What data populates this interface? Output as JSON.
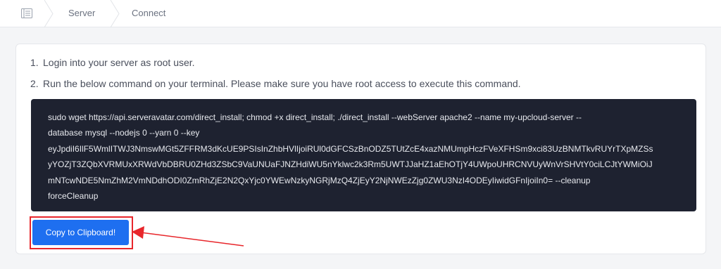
{
  "breadcrumb": {
    "items": [
      "Server",
      "Connect"
    ]
  },
  "steps": [
    {
      "num": "1.",
      "text": "Login into your server as root user."
    },
    {
      "num": "2.",
      "text": "Run the below command on your terminal. Please make sure you have root access to execute this command."
    }
  ],
  "command": {
    "lines": [
      "sudo wget https://api.serveravatar.com/direct_install; chmod +x direct_install; ./direct_install --webServer apache2 --name my-upcloud-server --",
      "database mysql --nodejs 0 --yarn 0 --key",
      "eyJpdiI6IlF5WmlITWJ3NmswMGt5ZFFRM3dKcUE9PSIsInZhbHVlIjoiRUl0dGFCSzBnODZ5TUtZcE4xazNMUmpHczFVeXFHSm9xci83UzBNMTkvRUYrTXpMZSs",
      "yYOZjT3ZQbXVRMUxXRWdVbDBRU0ZHd3ZSbC9VaUNUaFJNZHdiWU5nYklwc2k3Rm5UWTJJaHZ1aEhOTjY4UWpoUHRCNVUyWnVrSHVtY0ciLCJtYWMiOiJ",
      "mNTcwNDE5NmZhM2VmNDdhODI0ZmRhZjE2N2QxYjc0YWEwNzkyNGRjMzQ4ZjEyY2NjNWEzZjg0ZWU3NzI4ODEyIiwidGFnIjoiIn0= --cleanup",
      "forceCleanup"
    ]
  },
  "copy_button": {
    "label": "Copy to Clipboard!"
  },
  "colors": {
    "accent": "#1e6ff0",
    "highlight": "#e8262b",
    "terminal_bg": "#1e2230"
  },
  "icons": {
    "home": "server-list-icon",
    "separator": "chevron-right-icon",
    "annotation": "red-arrow"
  }
}
